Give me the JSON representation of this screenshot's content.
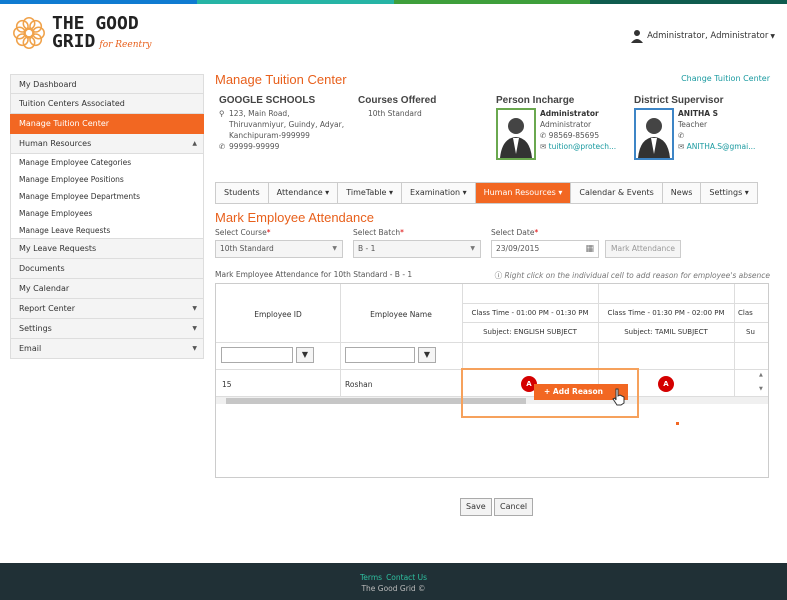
{
  "colors": {
    "accent": "#f26722",
    "link": "#1a9aa0",
    "topbar": [
      "#0f7bd1",
      "#26b4a5",
      "#3e9f3b",
      "#0f5c4f"
    ]
  },
  "header": {
    "logo_line1": "THE GOOD",
    "logo_line2": "GRID",
    "logo_tag": "for Reentry",
    "user": "Administrator, Administrator"
  },
  "sidebar": {
    "my_dashboard": "My Dashboard",
    "tuition_centers": "Tuition Centers Associated",
    "manage_tuition": "Manage Tuition Center",
    "human_resources": "Human Resources",
    "hr_sub": [
      "Manage Employee Categories",
      "Manage Employee Positions",
      "Manage Employee Departments",
      "Manage Employees",
      "Manage Leave Requests"
    ],
    "my_leave": "My Leave Requests",
    "documents": "Documents",
    "my_calendar": "My Calendar",
    "report_center": "Report Center",
    "settings": "Settings",
    "email": "Email"
  },
  "main": {
    "title": "Manage Tuition Center",
    "change_link": "Change Tuition Center",
    "school": {
      "name": "GOOGLE SCHOOLS",
      "addr1": "123, Main Road,",
      "addr2": "Thiruvanmiyur, Guindy, Adyar,",
      "addr3": "Kanchipuram-999999",
      "phone": "99999-99999"
    },
    "courses": {
      "title": "Courses Offered",
      "item": "10th Standard"
    },
    "incharge": {
      "title": "Person Incharge",
      "name": "Administrator",
      "role": "Administrator",
      "phone": "98569-85695",
      "email": "tuition@protech..."
    },
    "district": {
      "title": "District Supervisor",
      "name": "ANITHA S",
      "role": "Teacher",
      "phone": "",
      "email": "ANITHA.S@gmai..."
    },
    "tabs": [
      "Students",
      "Attendance ▾",
      "TimeTable ▾",
      "Examination ▾",
      "Human Resources ▾",
      "Calendar & Events",
      "News",
      "Settings ▾"
    ],
    "section_title": "Mark Employee Attendance",
    "course_label": "Select Course",
    "course_value": "10th Standard",
    "batch_label": "Select Batch",
    "batch_value": "B - 1",
    "date_label": "Select Date",
    "date_value": "23/09/2015",
    "mark_btn": "Mark Attendance",
    "for_line": "Mark Employee Attendance for  10th Standard - B - 1",
    "hint": "Right click on the individual cell to add reason for employee's absence",
    "grid": {
      "col_id": "Employee ID",
      "col_name": "Employee Name",
      "class1_time": "Class Time - 01:00 PM - 01:30 PM",
      "class1_subject": "Subject:  ENGLISH SUBJECT",
      "class2_time": "Class Time - 01:30 PM - 02:00 PM",
      "class2_subject": "Subject:  TAMIL SUBJECT",
      "class3_time": "Clas",
      "class3_subject": "Su",
      "row": {
        "id": "15",
        "name": "Roshan",
        "mark1": "A",
        "mark2": "A"
      },
      "context_item": "Add Reason"
    },
    "save": "Save",
    "cancel": "Cancel"
  },
  "footer": {
    "terms": "Terms",
    "contact": "Contact Us",
    "copy": "The Good Grid ©"
  }
}
